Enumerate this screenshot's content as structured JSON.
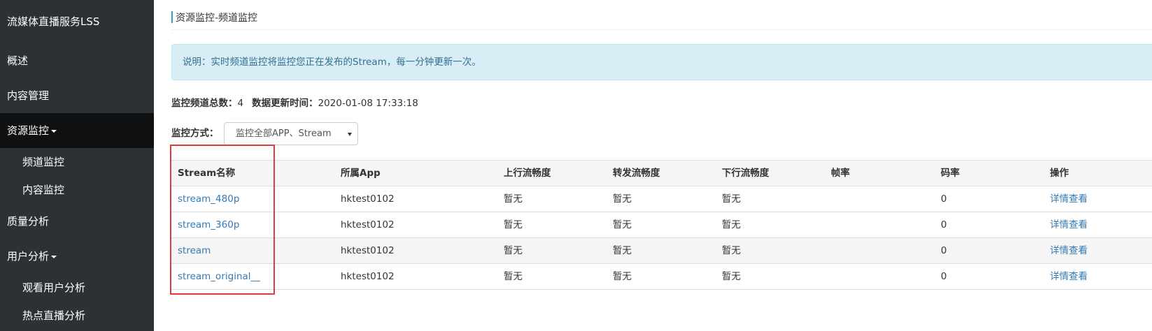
{
  "sidebar": {
    "brand": "流媒体直播服务LSS",
    "items": [
      {
        "label": "概述"
      },
      {
        "label": "内容管理"
      },
      {
        "label": "资源监控"
      },
      {
        "label": "频道监控"
      },
      {
        "label": "内容监控"
      },
      {
        "label": "质量分析"
      },
      {
        "label": "用户分析"
      },
      {
        "label": "观看用户分析"
      },
      {
        "label": "热点直播分析"
      }
    ],
    "active_bg": "#0f1012",
    "bg": "#2c3136"
  },
  "page": {
    "title": "资源监控-频道监控",
    "notice": "说明：实时频道监控将监控您正在发布的Stream，每一分钟更新一次。",
    "total_label": "监控频道总数：",
    "total_value": "4",
    "updated_label": "数据更新时间：",
    "updated_value": "2020-01-08 17:33:18",
    "mode_label": "监控方式：",
    "mode_value": "监控全部APP、Stream"
  },
  "table": {
    "headers": [
      "Stream名称",
      "所属App",
      "上行流畅度",
      "转发流畅度",
      "下行流畅度",
      "帧率",
      "码率",
      "操作"
    ],
    "rows": [
      {
        "stream": "stream_480p",
        "app": "hktest0102",
        "up": "暂无",
        "forward": "暂无",
        "down": "暂无",
        "fps": "",
        "bitrate": "0",
        "action": "详情查看"
      },
      {
        "stream": "stream_360p",
        "app": "hktest0102",
        "up": "暂无",
        "forward": "暂无",
        "down": "暂无",
        "fps": "",
        "bitrate": "0",
        "action": "详情查看"
      },
      {
        "stream": "stream",
        "app": "hktest0102",
        "up": "暂无",
        "forward": "暂无",
        "down": "暂无",
        "fps": "",
        "bitrate": "0",
        "action": "详情查看"
      },
      {
        "stream": "stream_original__",
        "app": "hktest0102",
        "up": "暂无",
        "forward": "暂无",
        "down": "暂无",
        "fps": "",
        "bitrate": "0",
        "action": "详情查看"
      }
    ]
  },
  "colors": {
    "accent": "#27a3c4",
    "link": "#337ab7",
    "alert_bg": "#d9edf7",
    "alert_text": "#31708f",
    "highlight": "#e03c3c"
  }
}
